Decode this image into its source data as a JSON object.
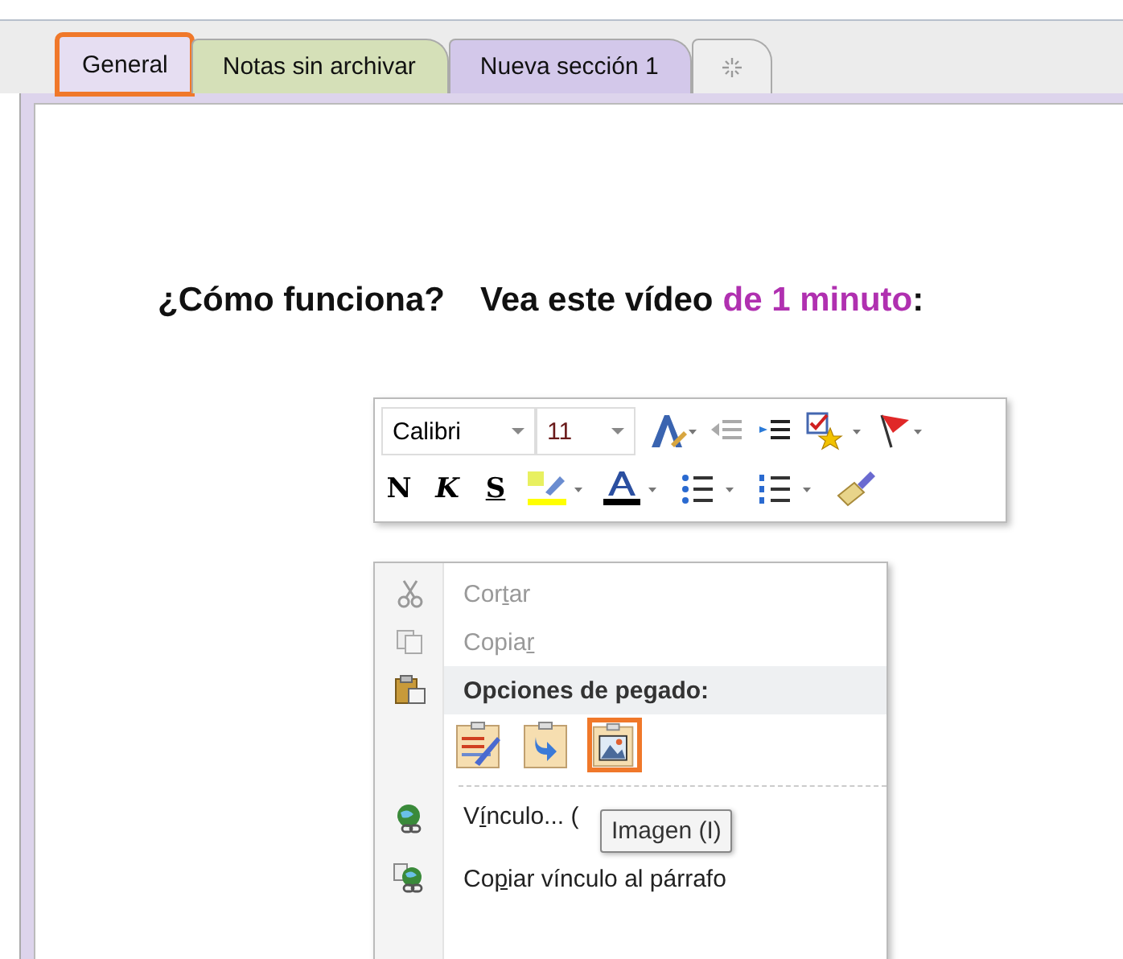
{
  "tabs": [
    {
      "label": "General",
      "selected": true,
      "color": "#e6def2",
      "highlighted": true
    },
    {
      "label": "Notas sin archivar",
      "selected": false,
      "color": "#d5e0b8",
      "highlighted": false
    },
    {
      "label": "Nueva sección 1",
      "selected": false,
      "color": "#d3c8ea",
      "highlighted": false
    },
    {
      "kind": "new",
      "selected": false,
      "color": "#eeeeee",
      "highlighted": false
    }
  ],
  "heading": [
    {
      "text": "¿Cómo funciona?",
      "accent": false
    },
    {
      "text": "Vea este vídeo",
      "accent": false
    },
    {
      "text": "de 1 minuto",
      "accent": true
    },
    {
      "text": ":",
      "accent": false
    }
  ],
  "mini_toolbar": {
    "font": "Calibri",
    "size": "11",
    "format_buttons": [
      "N",
      "K",
      "S"
    ]
  },
  "context_menu": {
    "items": [
      {
        "kind": "item",
        "label": [
          {
            "text": "Cor"
          },
          {
            "text": "t",
            "underline": true
          },
          {
            "text": "ar"
          }
        ],
        "disabled": true
      },
      {
        "kind": "item",
        "label": [
          {
            "text": "Copia"
          },
          {
            "text": "r",
            "underline": true
          }
        ],
        "disabled": true
      },
      {
        "kind": "header",
        "label": "Opciones de pegado:"
      },
      {
        "kind": "paste_options",
        "options": [
          {
            "highlighted": false
          },
          {
            "highlighted": false
          },
          {
            "highlighted": true
          }
        ]
      },
      {
        "kind": "separator"
      },
      {
        "kind": "item",
        "label": [
          {
            "text": "V"
          },
          {
            "text": "í",
            "underline": true
          },
          {
            "text": "nculo... ("
          }
        ],
        "disabled": false
      },
      {
        "kind": "item",
        "label": [
          {
            "text": "Co"
          },
          {
            "text": "p",
            "underline": true
          },
          {
            "text": "iar vínculo al párrafo"
          }
        ],
        "disabled": false
      }
    ]
  },
  "tooltip": "Imagen (I)"
}
